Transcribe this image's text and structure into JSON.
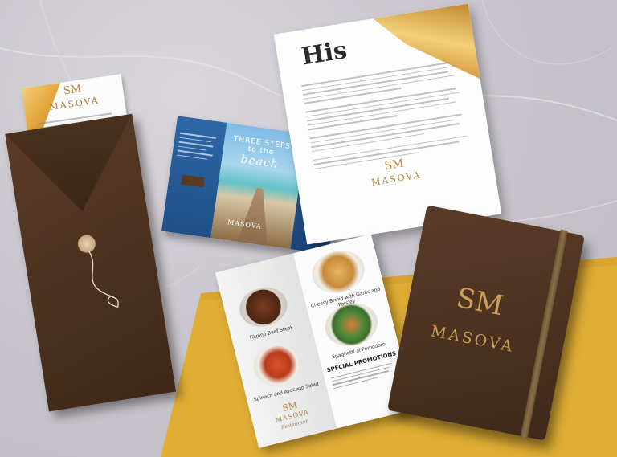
{
  "scene": {
    "colors": {
      "background": "#c9c6cd",
      "gold": "#e0ae35",
      "leather": "#4a301e",
      "brand_gold": "#c9a056"
    }
  },
  "letter_left": {
    "monogram": "SM",
    "brand": "MASOVA"
  },
  "history_letter": {
    "heading": "His",
    "monogram": "SM",
    "brand": "MASOVA"
  },
  "trifold": {
    "title_top": "THREE STEPS",
    "title_mid": "to the",
    "title_script": "beach",
    "brand": "MASOVA"
  },
  "menu": {
    "captions": [
      "Filipino Beef Steak",
      "Cheesy Bread with Garlic and Parsley",
      "Spinach and Avocado Salad",
      "Spaghetti al Pomodoro"
    ],
    "promo_title": "SPECIAL PROMOTIONS",
    "monogram": "SM",
    "brand": "MASOVA",
    "sub": "Restaurant"
  },
  "notebook": {
    "monogram": "SM",
    "brand": "MASOVA"
  }
}
